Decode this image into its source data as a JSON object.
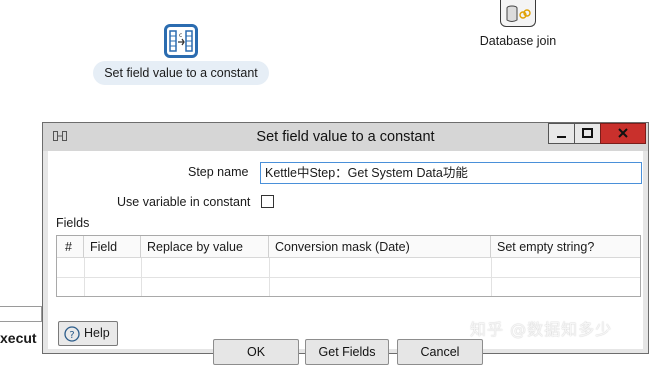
{
  "canvas": {
    "step_label": "Set field value to a constant",
    "db_join_label": "Database join",
    "left_fragment": "",
    "left_exec_text": "xecut"
  },
  "dialog": {
    "title": "Set field value to a constant",
    "step_name_label": "Step name",
    "step_name_value": "Kettle中Step：Get System Data功能",
    "use_variable_label": "Use variable in constant",
    "use_variable_checked": false,
    "fields_label": "Fields",
    "table": {
      "columns": [
        "#",
        "Field",
        "Replace by value",
        "Conversion mask (Date)",
        "Set empty string?"
      ],
      "rows": []
    },
    "buttons": {
      "ok": "OK",
      "get_fields": "Get Fields",
      "cancel": "Cancel",
      "help": "Help"
    }
  },
  "window_controls": {
    "minimize_icon": "minimize-icon",
    "maximize_icon": "maximize-icon",
    "close_icon": "close-icon",
    "close_color": "#c9302c"
  },
  "watermark": "知乎 @数据知多少"
}
